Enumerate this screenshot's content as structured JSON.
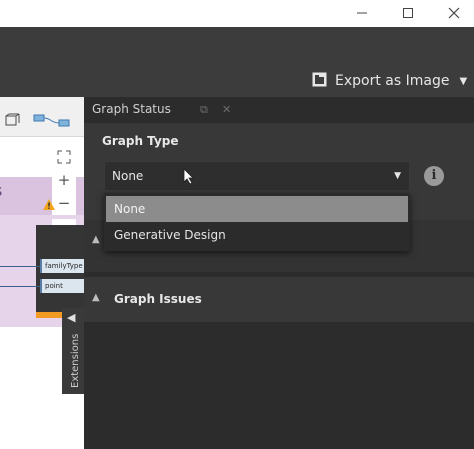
{
  "window": {
    "minimize_icon": "minimize-icon",
    "maximize_icon": "maximize-icon",
    "close_icon": "close-icon"
  },
  "toolbar": {
    "export_label": "Export as Image",
    "export_icon": "image-icon"
  },
  "canvas": {
    "group_title": "s",
    "ports": [
      "familyType",
      "point"
    ],
    "node_colors": {
      "header": "#353535",
      "port": "#dce6ef",
      "accent": "#f29a21"
    },
    "group_color": "#e6d5ea"
  },
  "panel": {
    "title": "Graph Status",
    "graph_type_label": "Graph Type",
    "selected_value": "None",
    "dropdown_options": [
      "None",
      "Generative Design"
    ],
    "graph_issues_label": "Graph Issues"
  },
  "extensions": {
    "label": "Extensions"
  }
}
